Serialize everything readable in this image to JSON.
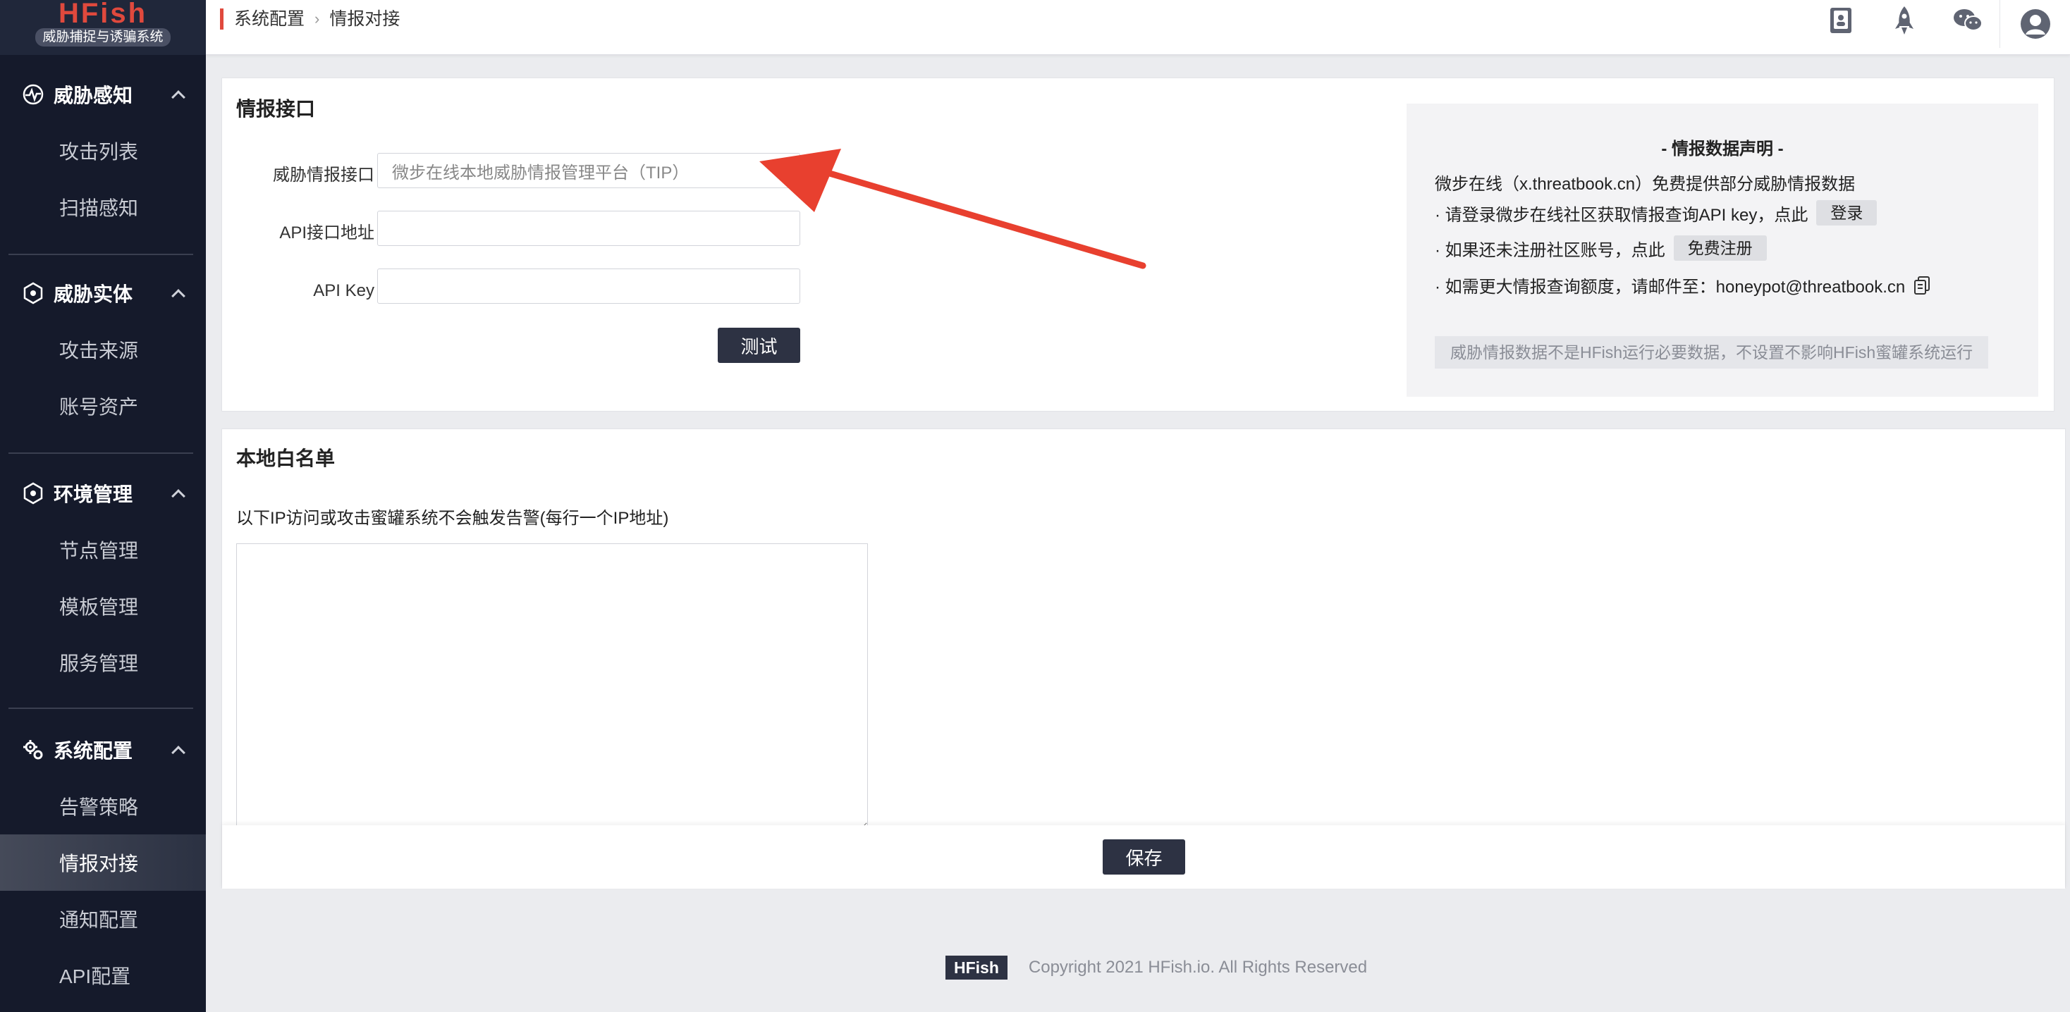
{
  "app": {
    "logo_title": "HFish",
    "logo_subtitle": "威胁捕捉与诱骗系统"
  },
  "sidebar": {
    "groups": [
      {
        "label": "威胁感知",
        "icon": "radar-icon",
        "items": [
          "攻击列表",
          "扫描感知"
        ]
      },
      {
        "label": "威胁实体",
        "icon": "hexagon-icon",
        "items": [
          "攻击来源",
          "账号资产"
        ]
      },
      {
        "label": "环境管理",
        "icon": "hexagon-icon",
        "items": [
          "节点管理",
          "模板管理",
          "服务管理"
        ]
      },
      {
        "label": "系统配置",
        "icon": "gears-icon",
        "items": [
          "告警策略",
          "情报对接",
          "通知配置",
          "API配置"
        ]
      }
    ],
    "active_item": "情报对接"
  },
  "header": {
    "breadcrumb": [
      "系统配置",
      "情报对接"
    ],
    "icons": [
      "docs-icon",
      "rocket-icon",
      "wechat-icon",
      "user-avatar-icon"
    ]
  },
  "intel": {
    "title": "情报接口",
    "fields": [
      {
        "label": "威胁情报接口：",
        "value": "微步在线本地威胁情报管理平台（TIP）",
        "placeholder": ""
      },
      {
        "label": "API接口地址：",
        "value": "",
        "placeholder": ""
      },
      {
        "label": "API Key：",
        "value": "",
        "placeholder": ""
      }
    ],
    "test_button": "测试",
    "notice": {
      "title": "- 情报数据声明 -",
      "line1": "微步在线（x.threatbook.cn）免费提供部分威胁情报数据",
      "line2": "· 请登录微步在线社区获取情报查询API key，点此",
      "login_button": "登录",
      "line3": "· 如果还未注册社区账号，点此",
      "register_button": "免费注册",
      "line4": "· 如需更大情报查询额度，请邮件至：honeypot@threatbook.cn",
      "footer": "威胁情报数据不是HFish运行必要数据，不设置不影响HFish蜜罐系统运行"
    }
  },
  "whitelist": {
    "title": "本地白名单",
    "description": "以下IP访问或攻击蜜罐系统不会触发告警(每行一个IP地址)",
    "value": "",
    "save_button": "保存"
  },
  "footer": {
    "badge": "HFish",
    "copyright": "Copyright 2021 HFish.io. All Rights Reserved"
  },
  "colors": {
    "sidebar_bg": "#151a2b",
    "accent_red": "#e0493d",
    "button_dark": "#2d3243",
    "annotation_arrow": "#e8402f"
  }
}
